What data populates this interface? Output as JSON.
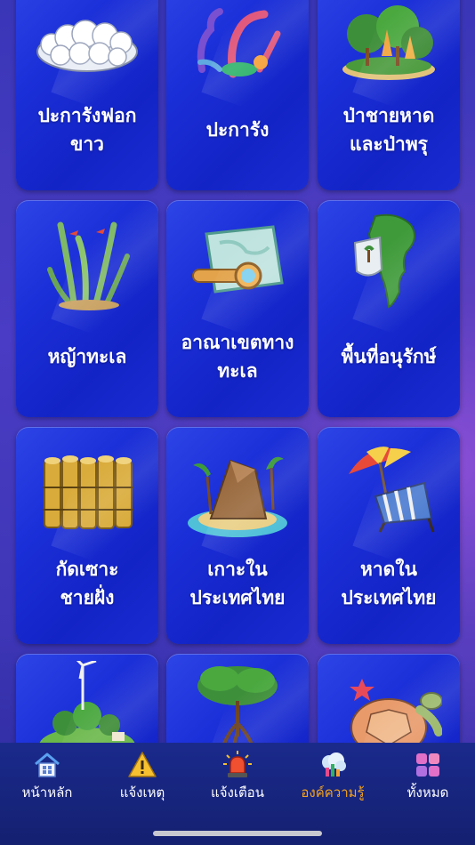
{
  "cards": [
    {
      "label": "ปะการังฟอก\nขาว",
      "icon": "bleached-coral-icon"
    },
    {
      "label": "ปะการัง",
      "icon": "coral-icon"
    },
    {
      "label": "ป่าชายหาด\nและป่าพรุ",
      "icon": "beach-forest-icon"
    },
    {
      "label": "หญ้าทะเล",
      "icon": "seagrass-icon"
    },
    {
      "label": "อาณาเขตทาง\nทะเล",
      "icon": "sea-map-icon"
    },
    {
      "label": "พื้นที่อนุรักษ์",
      "icon": "conservation-area-icon"
    },
    {
      "label": "กัดเซาะ\nชายฝั่ง",
      "icon": "coastal-erosion-icon"
    },
    {
      "label": "เกาะใน\nประเทศไทย",
      "icon": "island-icon"
    },
    {
      "label": "หาดใน\nประเทศไทย",
      "icon": "beach-chair-icon"
    },
    {
      "label": "",
      "icon": "wind-turbine-island-icon"
    },
    {
      "label": "",
      "icon": "mangrove-icon"
    },
    {
      "label": "",
      "icon": "sea-turtle-icon"
    }
  ],
  "tabbar": {
    "items": [
      {
        "label": "หน้าหลัก",
        "icon": "home-icon",
        "active": false
      },
      {
        "label": "แจ้งเหตุ",
        "icon": "warning-icon",
        "active": false
      },
      {
        "label": "แจ้งเตือน",
        "icon": "siren-icon",
        "active": false
      },
      {
        "label": "องค์ความรู้",
        "icon": "knowledge-icon",
        "active": true
      },
      {
        "label": "ทั้งหมด",
        "icon": "grid-apps-icon",
        "active": false
      }
    ],
    "active_color": "#f5a31a"
  }
}
